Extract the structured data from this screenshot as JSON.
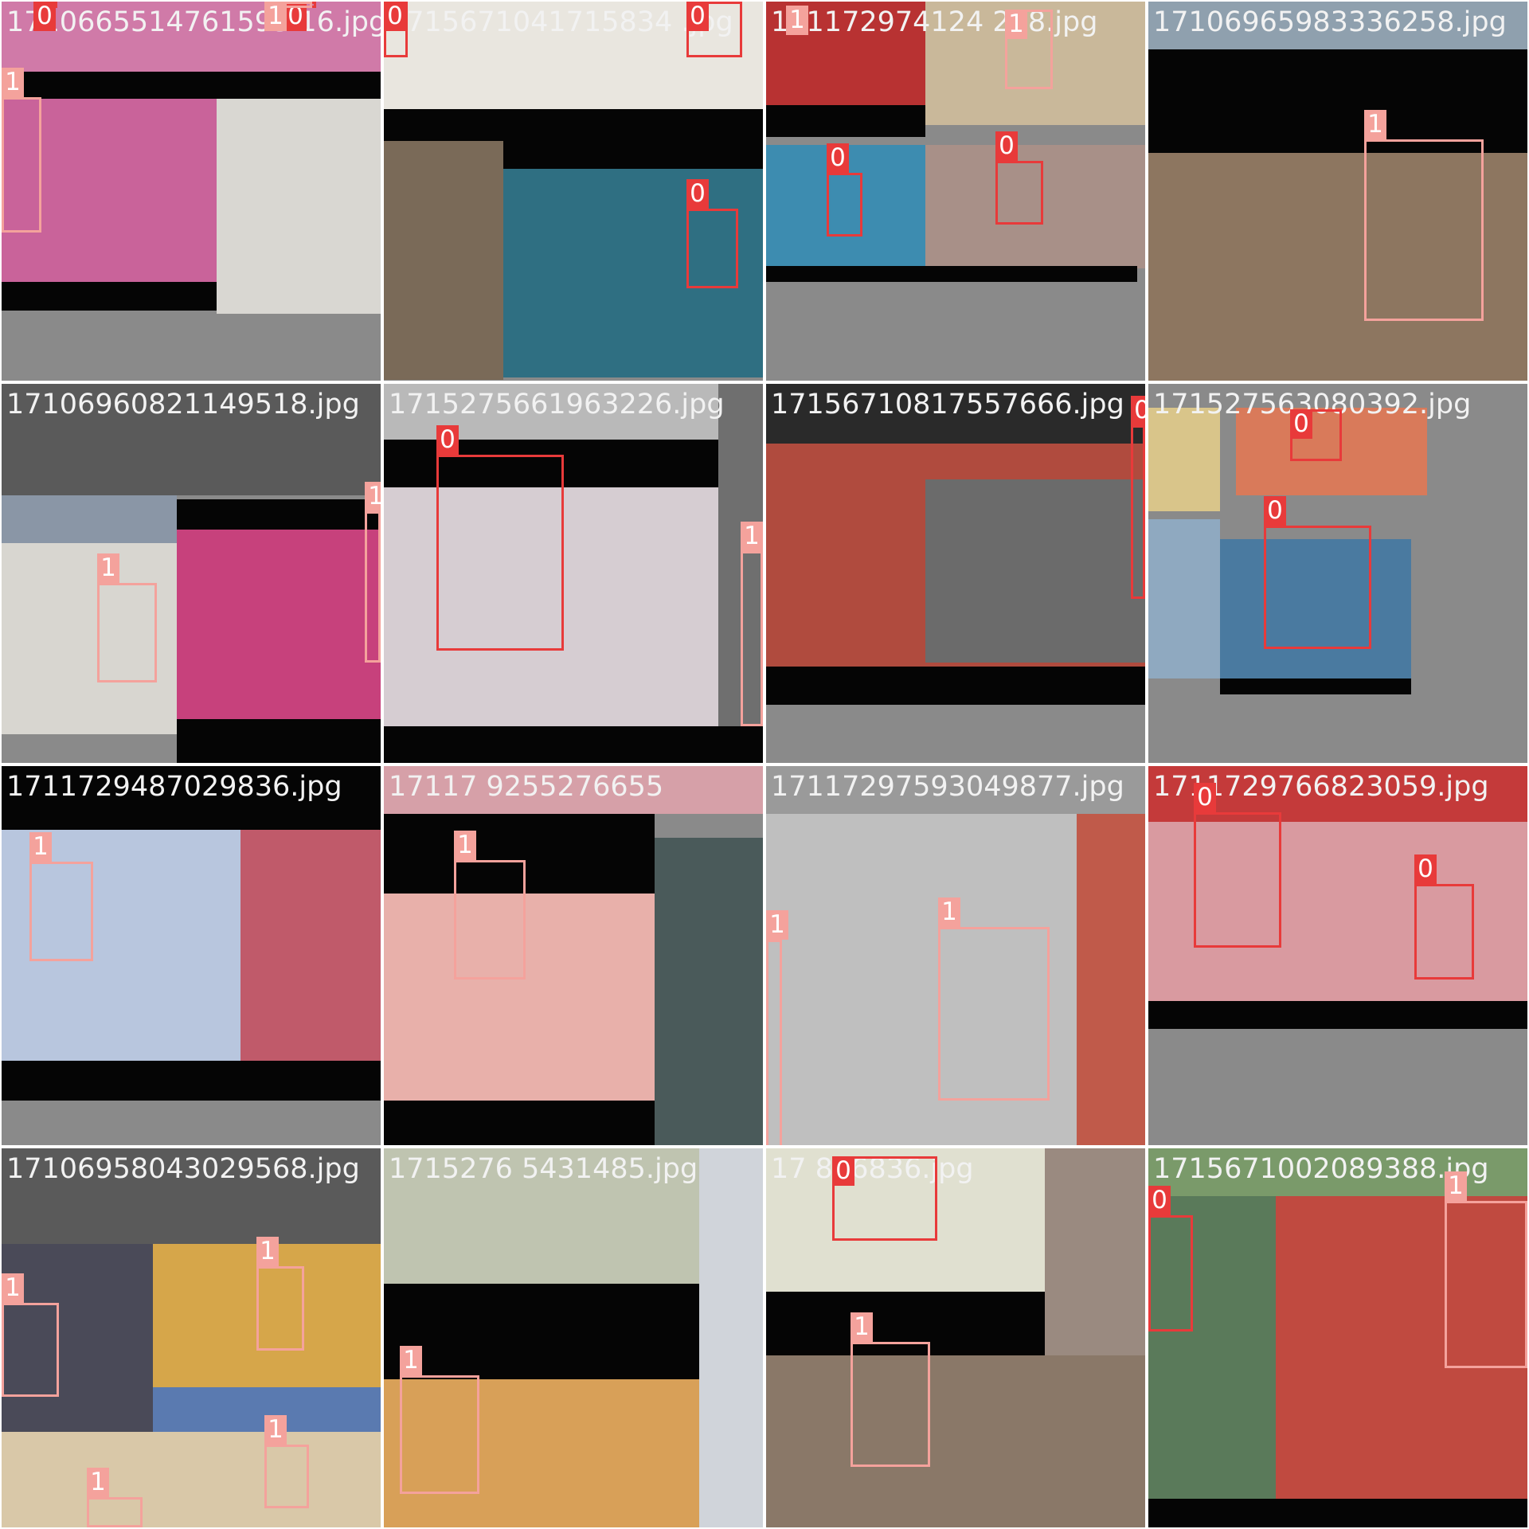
{
  "colors": {
    "class_0": "#e83a3a",
    "class_1": "#f4a29c",
    "letterbox_black": "#050505",
    "pad_gray": "#8a8a8a",
    "tile_gap": "#ffffff"
  },
  "grid": {
    "tiles": [
      {
        "filename": "1710665514761593 16.jpg",
        "labels": [
          "0",
          "1",
          "0",
          "1"
        ]
      },
      {
        "filename": "1715671041715834 .jpg",
        "labels": [
          "0",
          "0",
          "0"
        ]
      },
      {
        "filename": "171172974124 258.jpg",
        "labels": [
          "1",
          "1",
          "0",
          "0"
        ]
      },
      {
        "filename": "17106965983336258.jpg",
        "labels": [
          "1"
        ]
      },
      {
        "filename": "17106960821149518.jpg",
        "labels": [
          "1",
          "1"
        ]
      },
      {
        "filename": "1715275661963226.jpg",
        "labels": [
          "0",
          "1"
        ]
      },
      {
        "filename": "17156710817557666.jpg",
        "labels": [
          "0"
        ]
      },
      {
        "filename": "171527563080392.jpg",
        "labels": [
          "0",
          "0"
        ]
      },
      {
        "filename": "1711729487029836.jpg",
        "labels": [
          "1"
        ]
      },
      {
        "filename": "17117 9255276655",
        "labels": [
          "1"
        ]
      },
      {
        "filename": "17117297593049877.jpg",
        "labels": [
          "1",
          "1"
        ]
      },
      {
        "filename": "1711729766823059.jpg",
        "labels": [
          "0",
          "0"
        ]
      },
      {
        "filename": "17106958043029568.jpg",
        "labels": [
          "1",
          "1",
          "1",
          "1"
        ]
      },
      {
        "filename": "1715276 5431485.jpg",
        "labels": [
          "1"
        ]
      },
      {
        "filename": "17 896836.jpg",
        "labels": [
          "0",
          "1"
        ]
      },
      {
        "filename": "1715671002089388.jpg",
        "labels": [
          "0",
          "1"
        ]
      }
    ]
  }
}
